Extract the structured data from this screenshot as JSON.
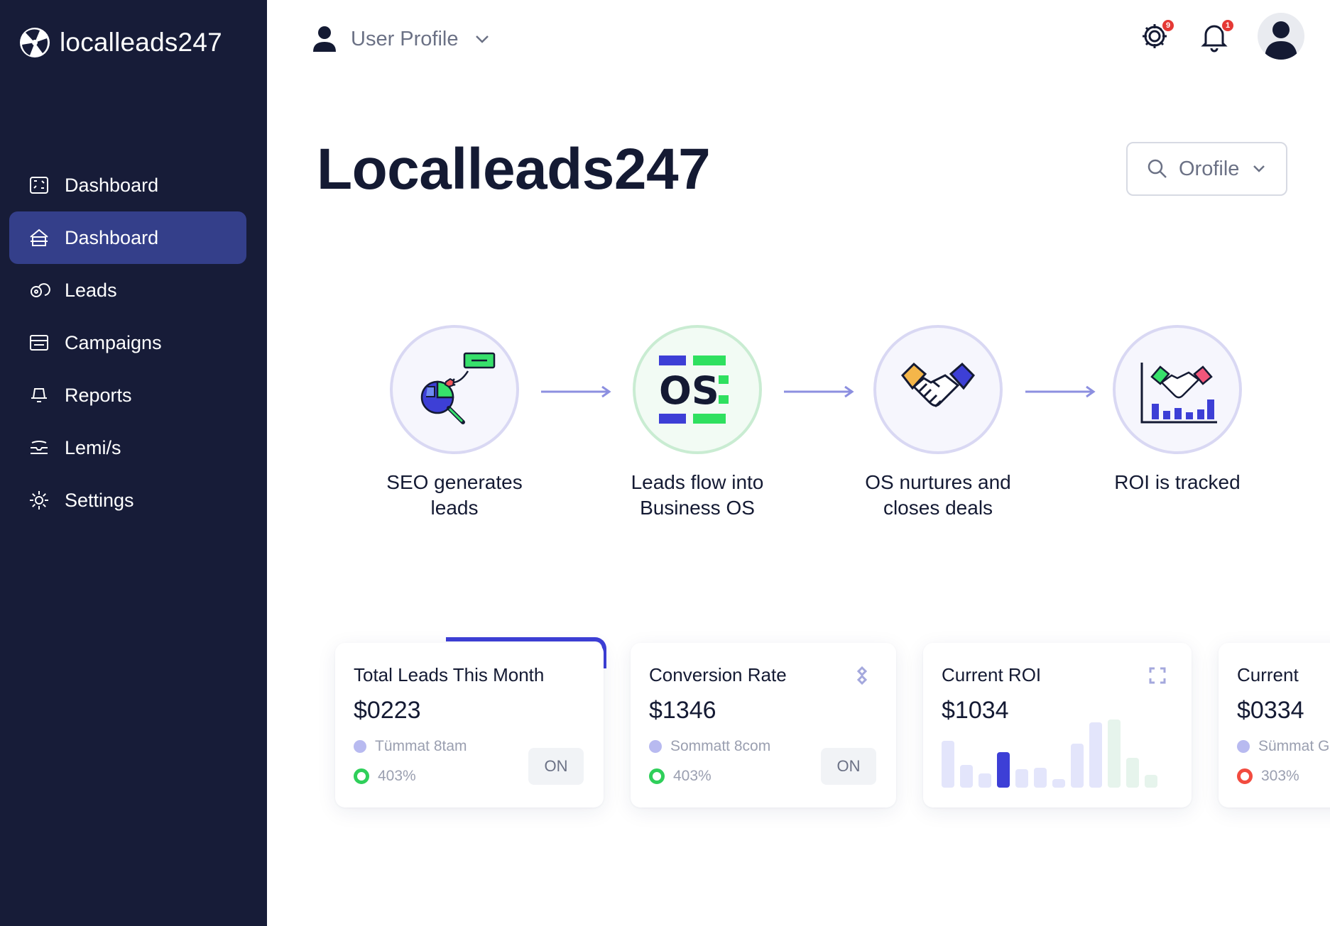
{
  "brand": {
    "name": "localleads247"
  },
  "sidebar": {
    "items": [
      {
        "label": "Dashboard",
        "icon": "dashboard-icon",
        "active": false
      },
      {
        "label": "Dashboard",
        "icon": "home-icon",
        "active": true
      },
      {
        "label": "Leads",
        "icon": "leads-icon",
        "active": false
      },
      {
        "label": "Campaigns",
        "icon": "campaigns-icon",
        "active": false
      },
      {
        "label": "Reports",
        "icon": "reports-icon",
        "active": false
      },
      {
        "label": "Lemi/s",
        "icon": "inbox-icon",
        "active": false
      },
      {
        "label": "Settings",
        "icon": "gear-icon",
        "active": false
      }
    ]
  },
  "topbar": {
    "profile_label": "User Profile",
    "settings_badge": "9",
    "notifications_badge": "1"
  },
  "page": {
    "title": "Localleads247",
    "profile_select": "Orofile"
  },
  "flow": {
    "steps": [
      {
        "label_line1": "SEO generates",
        "label_line2": "leads"
      },
      {
        "label_line1": "Leads flow into",
        "label_line2": "Business OS",
        "icon_text": "OS"
      },
      {
        "label_line1": "OS nurtures and",
        "label_line2": "closes deals"
      },
      {
        "label_line1": "ROI is tracked",
        "label_line2": ""
      }
    ]
  },
  "cards": [
    {
      "title": "Total Leads This Month",
      "value": "$0223",
      "meta": "Tümmat 8tam",
      "pct": "403%",
      "button": "ON"
    },
    {
      "title": "Conversion Rate",
      "value": "$1346",
      "meta": "Sommatt 8com",
      "pct": "403%",
      "button": "ON"
    },
    {
      "title": "Current ROI",
      "value": "$1034"
    },
    {
      "title": "Current",
      "value": "$0334",
      "meta": "Sümmat G",
      "pct": "303%"
    }
  ],
  "colors": {
    "sidebar_bg": "#171c38",
    "active_item": "#343f8a",
    "accent": "#3d3fd6",
    "positive": "#2fcf5a",
    "negative": "#f24b3f"
  }
}
